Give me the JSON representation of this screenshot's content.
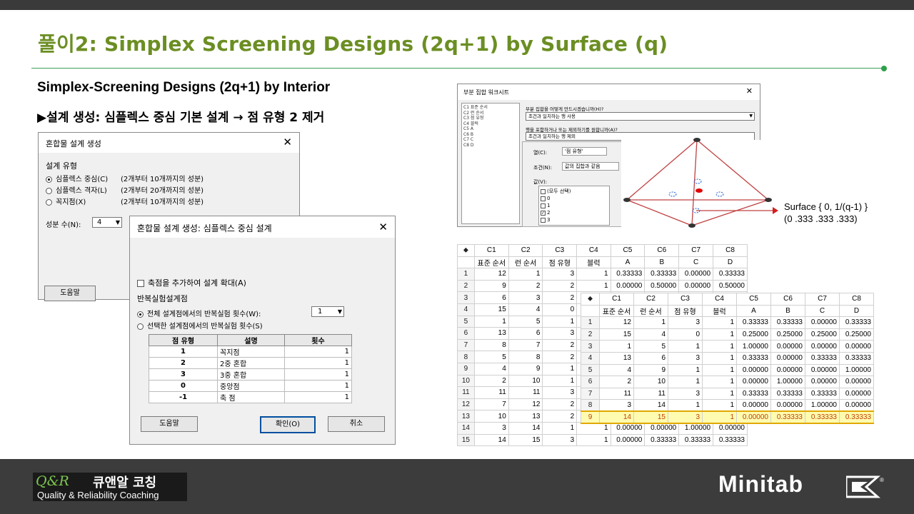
{
  "slide": {
    "title": "풀이2: Simplex Screening Designs (2q+1) by Surface (q)",
    "subtitle": "Simplex-Screening Designs (2q+1) by Interior",
    "bullet": "▶설계 생성: 심플렉스 중심 기본 설계 → 점 유형 2 제거"
  },
  "dlg1": {
    "title": "혼합물 설계 생성",
    "section": "설계 유형",
    "options": [
      {
        "label": "심플렉스 중심(C)",
        "range": "(2개부터 10개까지의 성분)"
      },
      {
        "label": "심플렉스 격자(L)",
        "range": "(2개부터 20개까지의 성분)"
      },
      {
        "label": "꼭지점(X)",
        "range": "(2개부터 10개까지의 성분)"
      }
    ],
    "comp_label": "성분 수(N):",
    "comp_value": "4",
    "help": "도움말"
  },
  "dlg2": {
    "title": "혼합물 설계 생성: 심플렉스 중심 설계",
    "augment_label": "축점을 추가하여 설계 확대(A)",
    "rep_section": "반복실험설계점",
    "rep_all": "전체 설계점에서의 반복실험 횟수(W):",
    "rep_all_value": "1",
    "rep_sel": "선택한 설계점에서의 반복실험 횟수(S)",
    "table_headers": [
      "점 유형",
      "설명",
      "횟수"
    ],
    "table_rows": [
      [
        "1",
        "꼭지점",
        "1"
      ],
      [
        "2",
        "2중 혼합",
        "1"
      ],
      [
        "3",
        "3중 혼합",
        "1"
      ],
      [
        "0",
        "중앙점",
        "1"
      ],
      [
        "-1",
        "축 점",
        "1"
      ]
    ],
    "help": "도움말",
    "ok": "확인(O)",
    "cancel": "취소"
  },
  "subset": {
    "title": "부분 집합 워크시트",
    "cols": [
      "C1   표준 순서",
      "C2   런 순서",
      "C3   점 유형",
      "C4   블럭",
      "C5   A",
      "C6   B",
      "C7   C",
      "C8   D"
    ],
    "q1": "부분 집합을 어떻게 만드시겠습니까(H)?",
    "q1_value": "조건과 일치하는 행 사용",
    "q2": "행을 포함하거나 또는 제외하기를 원합니까(A)?",
    "q2_value": "조건과 일치하는 행 제외",
    "col_label": "열(C):",
    "col_value": "'점 유형'",
    "cond_label": "조건(N):",
    "cond_value": "값의 집합과 같음",
    "val_label": "값(V):",
    "values": [
      "(모두 선택)",
      "0",
      "1",
      "2",
      "3"
    ],
    "checked": [
      false,
      false,
      false,
      true,
      false
    ]
  },
  "annotation": {
    "line1": "Surface { 0, 1/(q-1) }",
    "line2": "(0 .333 .333 .333)"
  },
  "ws1": {
    "cols": [
      "C1",
      "C2",
      "C3",
      "C4",
      "C5",
      "C6",
      "C7",
      "C8"
    ],
    "names": [
      "표준 순서",
      "런 순서",
      "점 유형",
      "블럭",
      "A",
      "B",
      "C",
      "D"
    ],
    "rows": [
      [
        "12",
        "1",
        "3",
        "1",
        "0.33333",
        "0.33333",
        "0.00000",
        "0.33333"
      ],
      [
        "9",
        "2",
        "2",
        "1",
        "0.00000",
        "0.50000",
        "0.00000",
        "0.50000"
      ],
      [
        "6",
        "3",
        "2",
        "",
        "",
        "",
        "",
        ""
      ],
      [
        "15",
        "4",
        "0",
        "",
        "",
        "",
        "",
        ""
      ],
      [
        "1",
        "5",
        "1",
        "",
        "",
        "",
        "",
        ""
      ],
      [
        "13",
        "6",
        "3",
        "",
        "",
        "",
        "",
        ""
      ],
      [
        "8",
        "7",
        "2",
        "",
        "",
        "",
        "",
        ""
      ],
      [
        "5",
        "8",
        "2",
        "",
        "",
        "",
        "",
        ""
      ],
      [
        "4",
        "9",
        "1",
        "",
        "",
        "",
        "",
        ""
      ],
      [
        "2",
        "10",
        "1",
        "",
        "",
        "",
        "",
        ""
      ],
      [
        "11",
        "11",
        "3",
        "",
        "",
        "",
        "",
        ""
      ],
      [
        "7",
        "12",
        "2",
        "",
        "",
        "",
        "",
        ""
      ],
      [
        "10",
        "13",
        "2",
        "",
        "",
        "",
        "",
        ""
      ],
      [
        "3",
        "14",
        "1",
        "1",
        "0.00000",
        "0.00000",
        "1.00000",
        "0.00000"
      ],
      [
        "14",
        "15",
        "3",
        "1",
        "0.00000",
        "0.33333",
        "0.33333",
        "0.33333"
      ]
    ]
  },
  "ws2": {
    "cols": [
      "C1",
      "C2",
      "C3",
      "C4",
      "C5",
      "C6",
      "C7",
      "C8"
    ],
    "names": [
      "표준 순서",
      "런 순서",
      "점 유형",
      "블럭",
      "A",
      "B",
      "C",
      "D"
    ],
    "rows": [
      [
        "12",
        "1",
        "3",
        "1",
        "0.33333",
        "0.33333",
        "0.00000",
        "0.33333"
      ],
      [
        "15",
        "4",
        "0",
        "1",
        "0.25000",
        "0.25000",
        "0.25000",
        "0.25000"
      ],
      [
        "1",
        "5",
        "1",
        "1",
        "1.00000",
        "0.00000",
        "0.00000",
        "0.00000"
      ],
      [
        "13",
        "6",
        "3",
        "1",
        "0.33333",
        "0.00000",
        "0.33333",
        "0.33333"
      ],
      [
        "4",
        "9",
        "1",
        "1",
        "0.00000",
        "0.00000",
        "0.00000",
        "1.00000"
      ],
      [
        "2",
        "10",
        "1",
        "1",
        "0.00000",
        "1.00000",
        "0.00000",
        "0.00000"
      ],
      [
        "11",
        "11",
        "3",
        "1",
        "0.33333",
        "0.33333",
        "0.33333",
        "0.00000"
      ],
      [
        "3",
        "14",
        "1",
        "1",
        "0.00000",
        "0.00000",
        "1.00000",
        "0.00000"
      ],
      [
        "14",
        "15",
        "3",
        "1",
        "0.00000",
        "0.33333",
        "0.33333",
        "0.33333"
      ]
    ],
    "highlight_row": 8
  },
  "footer": {
    "logo_qr": "Q&R",
    "logo_kr": "큐앤알 코칭",
    "logo_en": "Quality & Reliability Coaching",
    "brand": "Minitab"
  }
}
